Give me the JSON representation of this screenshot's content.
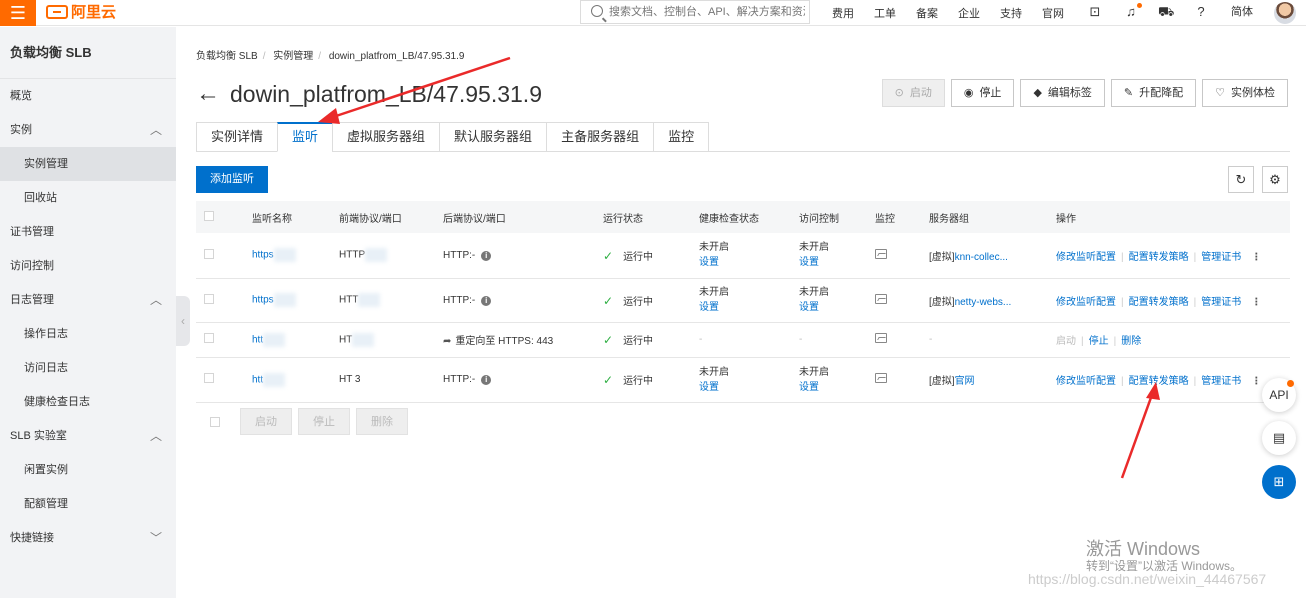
{
  "topbar": {
    "menu_icon": "hamburger-icon",
    "logo_text": "阿里云",
    "search_placeholder": "搜索文档、控制台、API、解决方案和资源",
    "nav": [
      "费用",
      "工单",
      "备案",
      "企业",
      "支持",
      "官网"
    ],
    "lang": "简体",
    "icons": [
      "terminal-icon",
      "bell-icon",
      "cart-icon",
      "help-icon"
    ]
  },
  "sidebar": {
    "title": "负载均衡 SLB",
    "items": [
      {
        "label": "概览",
        "level": 0
      },
      {
        "label": "实例",
        "level": 0,
        "expanded": true
      },
      {
        "label": "实例管理",
        "level": 1,
        "active": true
      },
      {
        "label": "回收站",
        "level": 1
      },
      {
        "label": "证书管理",
        "level": 0
      },
      {
        "label": "访问控制",
        "level": 0
      },
      {
        "label": "日志管理",
        "level": 0,
        "expanded": true
      },
      {
        "label": "操作日志",
        "level": 1
      },
      {
        "label": "访问日志",
        "level": 1
      },
      {
        "label": "健康检查日志",
        "level": 1
      },
      {
        "label": "SLB 实验室",
        "level": 0,
        "expanded": true
      },
      {
        "label": "闲置实例",
        "level": 1
      },
      {
        "label": "配额管理",
        "level": 1
      },
      {
        "label": "快捷链接",
        "level": 0,
        "expanded": false
      }
    ]
  },
  "breadcrumb": [
    "负载均衡 SLB",
    "实例管理",
    "dowin_platfrom_LB/47.95.31.9"
  ],
  "page_title": "dowin_platfrom_LB/47.95.31.9",
  "header_buttons": [
    {
      "label": "启动",
      "icon": "play-icon",
      "disabled": true
    },
    {
      "label": "停止",
      "icon": "stop-icon",
      "disabled": false
    },
    {
      "label": "编辑标签",
      "icon": "tag-icon",
      "disabled": false
    },
    {
      "label": "升配降配",
      "icon": "edit-icon",
      "disabled": false
    },
    {
      "label": "实例体检",
      "icon": "heart-icon",
      "disabled": false
    }
  ],
  "tabs": [
    "实例详情",
    "监听",
    "虚拟服务器组",
    "默认服务器组",
    "主备服务器组",
    "监控"
  ],
  "active_tab": 1,
  "add_listener": "添加监听",
  "table": {
    "columns": [
      "监听名称",
      "前端协议/端口",
      "后端协议/端口",
      "运行状态",
      "健康检查状态",
      "访问控制",
      "监控",
      "服务器组",
      "操作"
    ],
    "rows": [
      {
        "name": "https",
        "frontend": "HTTP",
        "backend": "HTTP:-",
        "status": "运行中",
        "health": "未开启",
        "health_link": "设置",
        "acl": "未开启",
        "acl_link": "设置",
        "group": "[虚拟]",
        "group_link": "knn-collec...",
        "ops": [
          "修改监听配置",
          "配置转发策略",
          "管理证书"
        ]
      },
      {
        "name": "https",
        "frontend": "HTT",
        "backend": "HTTP:-",
        "status": "运行中",
        "health": "未开启",
        "health_link": "设置",
        "acl": "未开启",
        "acl_link": "设置",
        "group": "[虚拟]",
        "group_link": "netty-webs...",
        "ops": [
          "修改监听配置",
          "配置转发策略",
          "管理证书"
        ]
      },
      {
        "name": "htt",
        "frontend": "HT",
        "backend": "重定向至 HTTPS: 443",
        "status": "运行中",
        "health": "-",
        "health_link": "",
        "acl": "-",
        "acl_link": "",
        "group": "-",
        "group_link": "",
        "ops": [
          "启动",
          "停止",
          "删除"
        ]
      },
      {
        "name": "htt",
        "frontend": "HT   3",
        "backend": "HTTP:-",
        "status": "运行中",
        "health": "未开启",
        "health_link": "设置",
        "acl": "未开启",
        "acl_link": "设置",
        "group": "[虚拟]",
        "group_link": "官网",
        "ops": [
          "修改监听配置",
          "配置转发策略",
          "管理证书"
        ]
      }
    ]
  },
  "bulk_buttons": [
    "启动",
    "停止",
    "删除"
  ],
  "floating": {
    "api": "API",
    "chat_icon": "chat-icon",
    "grid_icon": "apps-icon"
  },
  "watermark": {
    "line1": "激活 Windows",
    "line2": "转到“设置”以激活 Windows。",
    "url": "https://blog.csdn.net/weixin_44467567"
  }
}
